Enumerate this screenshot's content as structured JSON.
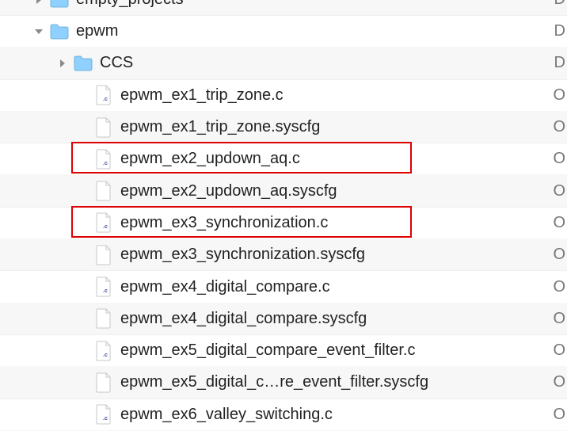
{
  "rows": [
    {
      "indent": 42,
      "disclosure": "right",
      "icon": "folder",
      "name": "empty_projects",
      "status": "D",
      "cutTop": true
    },
    {
      "indent": 42,
      "disclosure": "down",
      "icon": "folder",
      "name": "epwm",
      "status": "D"
    },
    {
      "indent": 72,
      "disclosure": "right",
      "icon": "folder",
      "name": "CCS",
      "status": "D"
    },
    {
      "indent": 98,
      "disclosure": "none",
      "icon": "cfile",
      "name": "epwm_ex1_trip_zone.c",
      "status": "O"
    },
    {
      "indent": 98,
      "disclosure": "none",
      "icon": "file",
      "name": "epwm_ex1_trip_zone.syscfg",
      "status": "O"
    },
    {
      "indent": 98,
      "disclosure": "none",
      "icon": "cfile",
      "name": "epwm_ex2_updown_aq.c",
      "status": "O",
      "highlight": true
    },
    {
      "indent": 98,
      "disclosure": "none",
      "icon": "file",
      "name": "epwm_ex2_updown_aq.syscfg",
      "status": "O"
    },
    {
      "indent": 98,
      "disclosure": "none",
      "icon": "cfile",
      "name": "epwm_ex3_synchronization.c",
      "status": "O",
      "highlight": true
    },
    {
      "indent": 98,
      "disclosure": "none",
      "icon": "file",
      "name": "epwm_ex3_synchronization.syscfg",
      "status": "O"
    },
    {
      "indent": 98,
      "disclosure": "none",
      "icon": "cfile",
      "name": "epwm_ex4_digital_compare.c",
      "status": "O"
    },
    {
      "indent": 98,
      "disclosure": "none",
      "icon": "file",
      "name": "epwm_ex4_digital_compare.syscfg",
      "status": "O"
    },
    {
      "indent": 98,
      "disclosure": "none",
      "icon": "cfile",
      "name": "epwm_ex5_digital_compare_event_filter.c",
      "status": "O"
    },
    {
      "indent": 98,
      "disclosure": "none",
      "icon": "file",
      "name": "epwm_ex5_digital_c…re_event_filter.syscfg",
      "status": "O"
    },
    {
      "indent": 98,
      "disclosure": "none",
      "icon": "cfile",
      "name": "epwm_ex6_valley_switching.c",
      "status": "O"
    }
  ]
}
